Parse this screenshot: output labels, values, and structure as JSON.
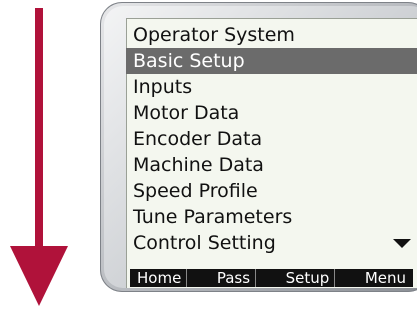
{
  "menu": {
    "items": [
      {
        "label": "Operator System",
        "selected": false
      },
      {
        "label": "Basic Setup",
        "selected": true
      },
      {
        "label": "Inputs",
        "selected": false
      },
      {
        "label": "Motor Data",
        "selected": false
      },
      {
        "label": "Encoder Data",
        "selected": false
      },
      {
        "label": "Machine Data",
        "selected": false
      },
      {
        "label": "Speed Profile",
        "selected": false
      },
      {
        "label": "Tune Parameters",
        "selected": false
      },
      {
        "label": "Control Setting",
        "selected": false
      }
    ]
  },
  "softkeys": {
    "home": "Home",
    "pass": "Pass",
    "setup": "Setup",
    "menu": "Menu"
  },
  "colors": {
    "arrow": "#b0123a",
    "highlight": "#6b6b6b",
    "lcd_background": "#f4f7ef",
    "softkey_bar": "#111111"
  },
  "icons": {
    "scroll": "triangle-down-icon",
    "arrow": "arrow-down-icon"
  }
}
